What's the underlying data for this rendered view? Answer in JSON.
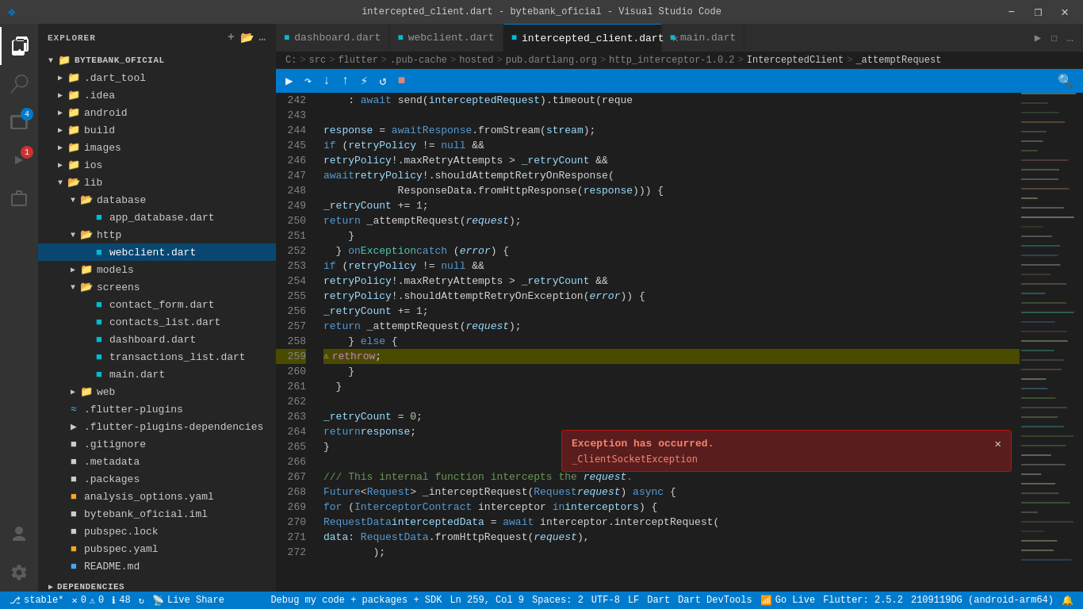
{
  "titleBar": {
    "title": "intercepted_client.dart - bytebank_oficial - Visual Studio Code",
    "logo": "VSCode",
    "windowControls": [
      "minimize",
      "maximize",
      "restore",
      "close"
    ]
  },
  "activityBar": {
    "items": [
      {
        "name": "explorer",
        "icon": "📄",
        "active": true
      },
      {
        "name": "search",
        "icon": "🔍",
        "active": false
      },
      {
        "name": "source-control",
        "icon": "⑂",
        "active": false,
        "badge": "4",
        "badgeColor": "blue"
      },
      {
        "name": "run",
        "icon": "▶",
        "active": false,
        "badge": "1",
        "badgeColor": "red"
      },
      {
        "name": "extensions",
        "icon": "⊞",
        "active": false
      },
      {
        "name": "settings",
        "icon": "⚙",
        "active": false,
        "bottom": true
      }
    ]
  },
  "sidebar": {
    "title": "EXPLORER",
    "rootFolder": "BYTEBANK_OFICIAL",
    "tree": [
      {
        "id": 1,
        "label": ".dart_tool",
        "depth": 1,
        "type": "folder",
        "collapsed": true,
        "icon": "folder"
      },
      {
        "id": 2,
        "label": ".idea",
        "depth": 1,
        "type": "folder",
        "collapsed": true,
        "icon": "folder"
      },
      {
        "id": 3,
        "label": "android",
        "depth": 1,
        "type": "folder",
        "collapsed": true,
        "icon": "folder-android"
      },
      {
        "id": 4,
        "label": "build",
        "depth": 1,
        "type": "folder",
        "collapsed": true,
        "icon": "folder"
      },
      {
        "id": 5,
        "label": "images",
        "depth": 1,
        "type": "folder",
        "collapsed": true,
        "icon": "folder"
      },
      {
        "id": 6,
        "label": "ios",
        "depth": 1,
        "type": "folder",
        "collapsed": true,
        "icon": "folder"
      },
      {
        "id": 7,
        "label": "lib",
        "depth": 1,
        "type": "folder",
        "collapsed": false,
        "icon": "folder-open"
      },
      {
        "id": 8,
        "label": "database",
        "depth": 2,
        "type": "folder",
        "collapsed": false,
        "icon": "folder-open"
      },
      {
        "id": 9,
        "label": "app_database.dart",
        "depth": 3,
        "type": "file",
        "icon": "dart"
      },
      {
        "id": 10,
        "label": "http",
        "depth": 2,
        "type": "folder",
        "collapsed": false,
        "icon": "folder-open"
      },
      {
        "id": 11,
        "label": "webclient.dart",
        "depth": 3,
        "type": "file",
        "icon": "dart",
        "selected": true
      },
      {
        "id": 12,
        "label": "models",
        "depth": 2,
        "type": "folder",
        "collapsed": true,
        "icon": "folder"
      },
      {
        "id": 13,
        "label": "screens",
        "depth": 2,
        "type": "folder",
        "collapsed": false,
        "icon": "folder-open"
      },
      {
        "id": 14,
        "label": "contact_form.dart",
        "depth": 3,
        "type": "file",
        "icon": "dart"
      },
      {
        "id": 15,
        "label": "contacts_list.dart",
        "depth": 3,
        "type": "file",
        "icon": "dart"
      },
      {
        "id": 16,
        "label": "dashboard.dart",
        "depth": 3,
        "type": "file",
        "icon": "dart"
      },
      {
        "id": 17,
        "label": "transactions_list.dart",
        "depth": 3,
        "type": "file",
        "icon": "dart"
      },
      {
        "id": 18,
        "label": "main.dart",
        "depth": 3,
        "type": "file",
        "icon": "dart"
      },
      {
        "id": 19,
        "label": "web",
        "depth": 2,
        "type": "folder",
        "collapsed": true,
        "icon": "folder"
      },
      {
        "id": 20,
        "label": ".flutter-plugins",
        "depth": 1,
        "type": "file",
        "icon": "generic"
      },
      {
        "id": 21,
        "label": ".flutter-plugins-dependencies",
        "depth": 1,
        "type": "file",
        "icon": "generic"
      },
      {
        "id": 22,
        "label": ".gitignore",
        "depth": 1,
        "type": "file",
        "icon": "git"
      },
      {
        "id": 23,
        "label": ".metadata",
        "depth": 1,
        "type": "file",
        "icon": "generic"
      },
      {
        "id": 24,
        "label": ".packages",
        "depth": 1,
        "type": "file",
        "icon": "generic"
      },
      {
        "id": 25,
        "label": "analysis_options.yaml",
        "depth": 1,
        "type": "file",
        "icon": "yaml"
      },
      {
        "id": 26,
        "label": "bytebank_oficial.iml",
        "depth": 1,
        "type": "file",
        "icon": "generic"
      },
      {
        "id": 27,
        "label": "pubspec.lock",
        "depth": 1,
        "type": "file",
        "icon": "generic"
      },
      {
        "id": 28,
        "label": "pubspec.yaml",
        "depth": 1,
        "type": "file",
        "icon": "yaml"
      },
      {
        "id": 29,
        "label": "README.md",
        "depth": 1,
        "type": "file",
        "icon": "markdown"
      }
    ],
    "section2": "DEPENDENCIES"
  },
  "tabs": [
    {
      "label": "dashboard.dart",
      "icon": "dart",
      "active": false,
      "closeable": true
    },
    {
      "label": "webclient.dart",
      "icon": "dart",
      "active": false,
      "closeable": true
    },
    {
      "label": "intercepted_client.dart",
      "icon": "dart",
      "active": true,
      "closeable": true
    },
    {
      "label": "main.dart",
      "icon": "dart",
      "active": false,
      "closeable": false
    }
  ],
  "breadcrumb": {
    "items": [
      "C:",
      "src",
      "flutter",
      ".pub-cache",
      "hosted",
      "pub.dartlang.org",
      "http_interceptor-1.0.2",
      "InterceptedClient",
      "_attemptRequest"
    ]
  },
  "debugToolbar": {
    "buttons": [
      "continue",
      "step-over",
      "step-into",
      "step-out",
      "restart",
      "stop",
      "hot-reload",
      "hot-restart"
    ]
  },
  "codeLines": [
    {
      "num": 242,
      "content": "    : await send(interceptedRequest).timeout(reque",
      "highlight": false
    },
    {
      "num": 243,
      "content": "",
      "highlight": false
    },
    {
      "num": 244,
      "content": "    response = await Response.fromStream(stream);",
      "highlight": false
    },
    {
      "num": 245,
      "content": "    if (retryPolicy != null &&",
      "highlight": false
    },
    {
      "num": 246,
      "content": "        retryPolicy!.maxRetryAttempts > _retryCount &&",
      "highlight": false
    },
    {
      "num": 247,
      "content": "        await retryPolicy!.shouldAttemptRetryOnResponse(",
      "highlight": false
    },
    {
      "num": 248,
      "content": "            ResponseData.fromHttpResponse(response))) {",
      "highlight": false
    },
    {
      "num": 249,
      "content": "      _retryCount += 1;",
      "highlight": false
    },
    {
      "num": 250,
      "content": "      return _attemptRequest(request);",
      "highlight": false
    },
    {
      "num": 251,
      "content": "    }",
      "highlight": false
    },
    {
      "num": 252,
      "content": "  } on Exception catch (error) {",
      "highlight": false
    },
    {
      "num": 253,
      "content": "    if (retryPolicy != null &&",
      "highlight": false
    },
    {
      "num": 254,
      "content": "        retryPolicy!.maxRetryAttempts > _retryCount &&",
      "highlight": false
    },
    {
      "num": 255,
      "content": "        retryPolicy!.shouldAttemptRetryOnException(error)) {",
      "highlight": false
    },
    {
      "num": 256,
      "content": "      _retryCount += 1;",
      "highlight": false
    },
    {
      "num": 257,
      "content": "      return _attemptRequest(request);",
      "highlight": false
    },
    {
      "num": 258,
      "content": "    } else {",
      "highlight": false
    },
    {
      "num": 259,
      "content": "      rethrow;",
      "highlight": true
    },
    {
      "num": 260,
      "content": "    }",
      "highlight": false
    },
    {
      "num": 261,
      "content": "  }",
      "highlight": false
    },
    {
      "num": 262,
      "content": "",
      "highlight": false
    },
    {
      "num": 263,
      "content": "  _retryCount = 0;",
      "highlight": false
    },
    {
      "num": 264,
      "content": "  return response;",
      "highlight": false
    },
    {
      "num": 265,
      "content": "}",
      "highlight": false
    },
    {
      "num": 266,
      "content": "",
      "highlight": false
    },
    {
      "num": 267,
      "content": "  /// This internal function intercepts the request.",
      "highlight": false
    },
    {
      "num": 268,
      "content": "  Future<Request> _interceptRequest(Request request) async {",
      "highlight": false
    },
    {
      "num": 269,
      "content": "    for (InterceptorContract interceptor in interceptors) {",
      "highlight": false
    },
    {
      "num": 270,
      "content": "      RequestData interceptedData = await interceptor.interceptRequest(",
      "highlight": false
    },
    {
      "num": 271,
      "content": "          data: RequestData.fromHttpRequest(request),",
      "highlight": false
    },
    {
      "num": 272,
      "content": "        );",
      "highlight": false
    }
  ],
  "exception": {
    "title": "Exception has occurred.",
    "message": "_ClientSocketException",
    "visible": true
  },
  "statusBar": {
    "branch": "stable*",
    "errors": "0",
    "warnings": "0",
    "info": "48",
    "liveshare": "Live Share",
    "debug": "Debug my code + packages + SDK",
    "position": "Ln 259, Col 9",
    "spaces": "Spaces: 2",
    "encoding": "UTF-8",
    "lineEnding": "LF",
    "language": "Dart",
    "devtools": "Dart DevTools",
    "golive": "Go Live",
    "flutter": "Flutter: 2.5.2",
    "device": "2109119DG (android-arm64)"
  }
}
